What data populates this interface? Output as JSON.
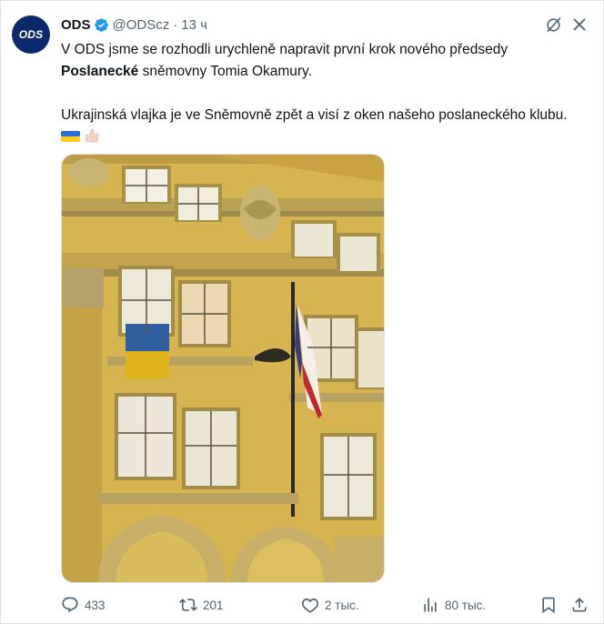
{
  "account": {
    "avatar_text": "ODS",
    "name": "ODS",
    "handle": "@ODScz",
    "separator": "·",
    "time": "13 ч"
  },
  "post": {
    "line1": "V ODS jsme se rozhodli urychleně napravit první krok nového předsedy",
    "bold_word": "Poslanecké",
    "line2_rest": " sněmovny Tomia Okamury.",
    "para2": "Ukrajinská vlajka je ve Sněmovně zpět a visí z oken našeho poslaneckého klubu."
  },
  "actions": {
    "replies": "433",
    "reposts": "201",
    "likes": "2 тыс.",
    "views": "80 тыс."
  },
  "icons": {
    "verified": "verified-badge-icon",
    "grok": "grok-icon",
    "more": "close-icon",
    "reply": "reply-icon",
    "repost": "repost-icon",
    "like": "heart-icon",
    "views": "analytics-icon",
    "bookmark": "bookmark-icon",
    "share": "share-icon"
  },
  "colors": {
    "muted": "#536471",
    "verified": "#1d9bf0",
    "avatar_bg": "#0b2a6b"
  }
}
